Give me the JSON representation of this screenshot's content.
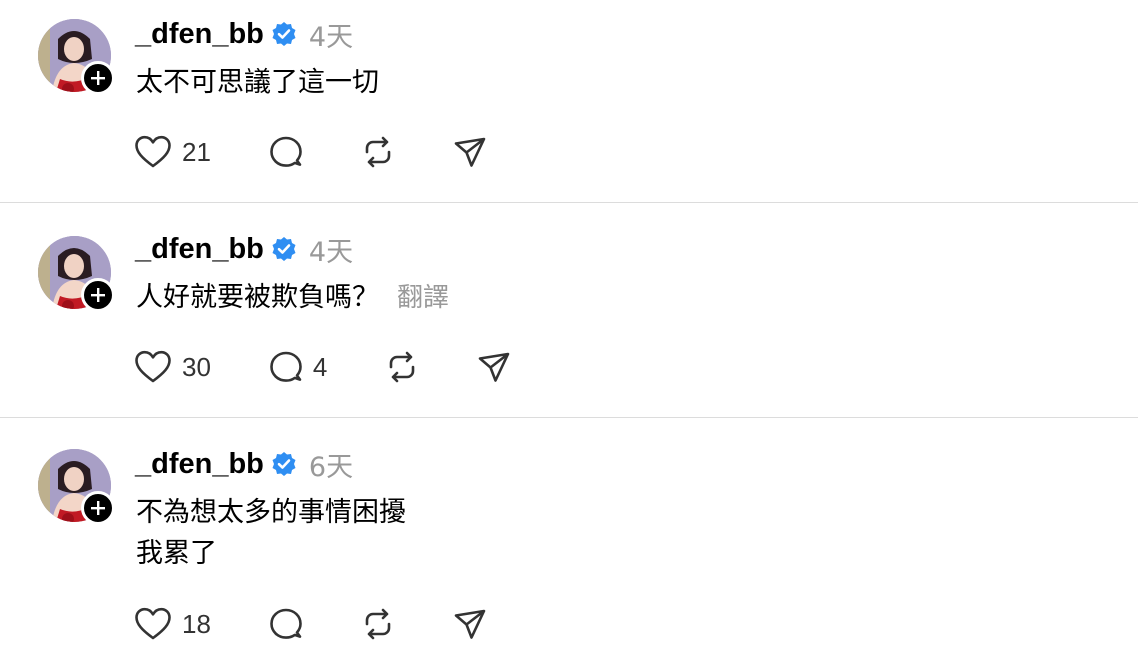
{
  "posts": [
    {
      "username": "_dfen_bb",
      "time": "4天",
      "lines": [
        "太不可思議了這一切"
      ],
      "translate": "",
      "likes": "21",
      "replies": ""
    },
    {
      "username": "_dfen_bb",
      "time": "4天",
      "lines": [
        "人好就要被欺負嗎？"
      ],
      "translate": "翻譯",
      "likes": "30",
      "replies": "4"
    },
    {
      "username": "_dfen_bb",
      "time": "6天",
      "lines": [
        "不為想太多的事情困擾",
        "我累了"
      ],
      "translate": "",
      "likes": "18",
      "replies": ""
    }
  ],
  "icons": {
    "like": "heart-icon",
    "reply": "comment-bubble-icon",
    "repost": "repost-icon",
    "share": "send-icon",
    "verified": "verified-badge-icon",
    "follow": "plus-icon"
  },
  "colors": {
    "verified": "#2f8ef2",
    "secondary_text": "#999999",
    "divider": "#dcdcdc"
  }
}
